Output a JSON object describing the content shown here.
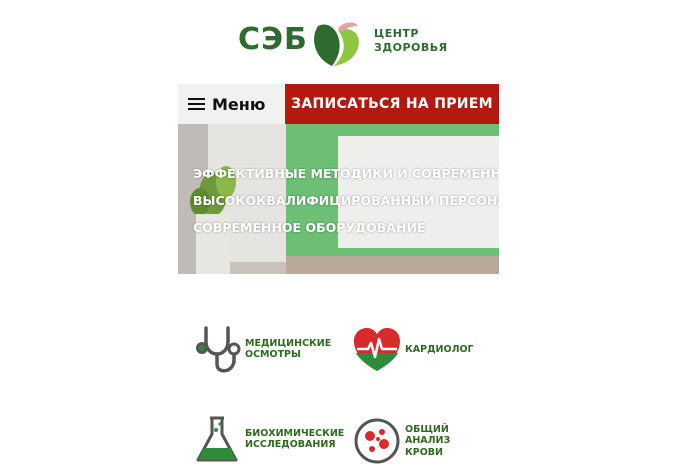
{
  "logo": {
    "brand": "СЭБ",
    "subtitle_line1": "ЦЕНТР",
    "subtitle_line2": "ЗДОРОВЬЯ",
    "colors": {
      "dark_green": "#2e6b2e",
      "light_green": "#8dc63f",
      "pink": "#e8a0a8"
    }
  },
  "header": {
    "menu_label": "Меню",
    "signup_label": "ЗАПИСАТЬСЯ НА ПРИЕМ",
    "signup_color": "#b3190f"
  },
  "hero": {
    "lines": [
      "ЭФФЕКТИВНЫЕ МЕТОДИКИ И СОВРЕМЕННЫЕ",
      "ВЫСОКОКВАЛИФИЦИРОВАННЫЙ ПЕРСОНАЛ",
      "СОВРЕМЕННОЕ ОБОРУДОВАНИЕ"
    ]
  },
  "services": [
    {
      "icon": "stethoscope-icon",
      "line1": "МЕДИЦИНСКИЕ",
      "line2": "ОСМОТРЫ",
      "line3": ""
    },
    {
      "icon": "heart-pulse-icon",
      "line1": "КАРДИОЛОГ",
      "line2": "",
      "line3": ""
    },
    {
      "icon": "flask-icon",
      "line1": "БИОХИМИЧЕСКИЕ",
      "line2": "ИССЛЕДОВАНИЯ",
      "line3": ""
    },
    {
      "icon": "blood-cells-icon",
      "line1": "ОБЩИЙ",
      "line2": "АНАЛИЗ",
      "line3": "КРОВИ"
    }
  ]
}
